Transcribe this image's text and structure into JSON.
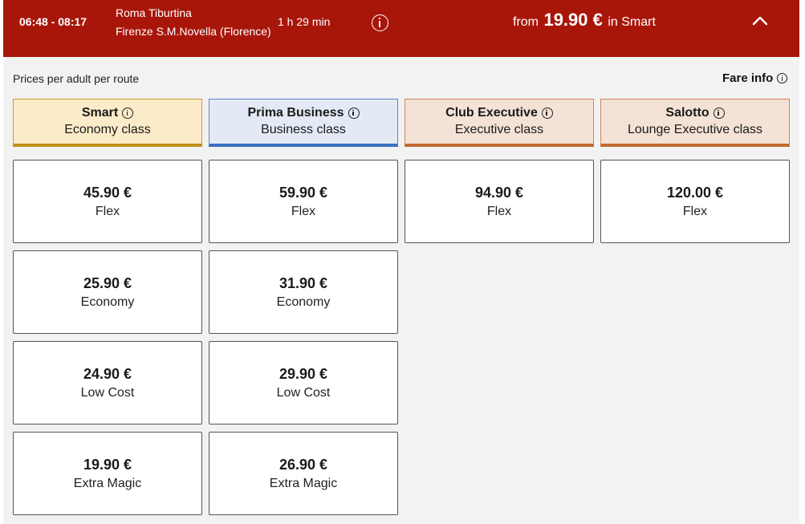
{
  "header": {
    "time_range": "06:48 - 08:17",
    "origin": "Roma Tiburtina",
    "destination": "Firenze S.M.Novella (Florence)",
    "duration": "1 h 29 min",
    "info_icon": "info-icon",
    "price_prefix": "from",
    "price": "19.90 €",
    "price_suffix": "in Smart",
    "collapse_icon": "chevron-up-icon",
    "background_color": "#a8160a"
  },
  "subtitle": "Prices per adult per route",
  "fare_info_label": "Fare info",
  "classes": [
    {
      "name": "Smart",
      "subtitle": "Economy class",
      "bg": "#fcebc9",
      "border": "#c99a2e",
      "accent": "#c0921c"
    },
    {
      "name": "Prima Business",
      "subtitle": "Business class",
      "bg": "#e3eaf5",
      "border": "#5a87c7",
      "accent": "#3a72c0"
    },
    {
      "name": "Club Executive",
      "subtitle": "Executive class",
      "bg": "#f4e2d6",
      "border": "#d0855c",
      "accent": "#c06a30"
    },
    {
      "name": "Salotto",
      "subtitle": "Lounge Executive class",
      "bg": "#f4e2d6",
      "border": "#d0855c",
      "accent": "#c06a30"
    }
  ],
  "fares": [
    [
      {
        "price": "45.90 €",
        "type": "Flex"
      },
      {
        "price": "25.90 €",
        "type": "Economy"
      },
      {
        "price": "24.90 €",
        "type": "Low Cost"
      },
      {
        "price": "19.90 €",
        "type": "Extra Magic"
      }
    ],
    [
      {
        "price": "59.90 €",
        "type": "Flex"
      },
      {
        "price": "31.90 €",
        "type": "Economy"
      },
      {
        "price": "29.90 €",
        "type": "Low Cost"
      },
      {
        "price": "26.90 €",
        "type": "Extra Magic"
      }
    ],
    [
      {
        "price": "94.90 €",
        "type": "Flex"
      }
    ],
    [
      {
        "price": "120.00 €",
        "type": "Flex"
      }
    ]
  ]
}
